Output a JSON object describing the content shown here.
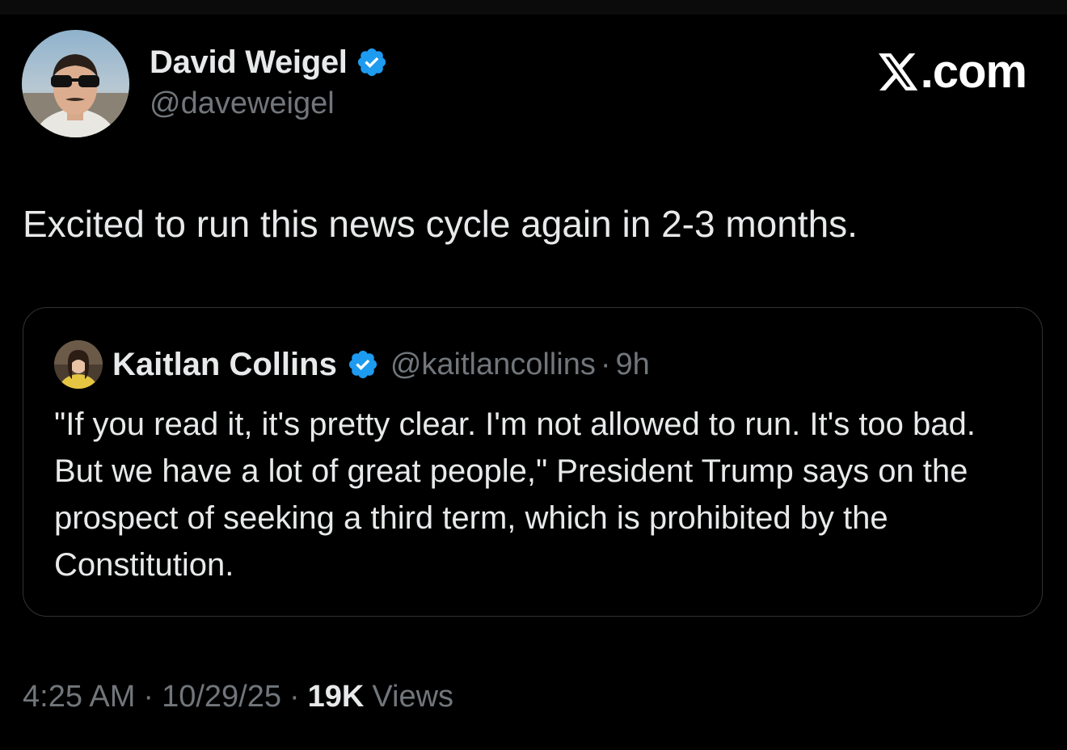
{
  "tweet": {
    "author": {
      "name": "David Weigel",
      "handle": "@daveweigel",
      "verified": true,
      "avatar": "author-avatar-photo"
    },
    "brand": {
      "label": ".com",
      "icon": "x-logo-icon",
      "color": "#ffffff"
    },
    "text": "Excited to run this news cycle again in 2-3 months.",
    "quoted": {
      "author_name": "Kaitlan Collins",
      "handle": "@kaitlancollins",
      "separator": "·",
      "time": "9h",
      "verified": true,
      "text": "\"If you read it, it's pretty clear. I'm not allowed to run. It's too bad. But we have a lot of great people,\" President Trump says on the prospect of seeking a third term, which is prohibited by the Constitution."
    },
    "meta": {
      "time": "4:25 AM",
      "separator": "·",
      "date": "10/29/25",
      "views_count": "19K",
      "views_label": "Views"
    }
  },
  "colors": {
    "background": "#000000",
    "primary_text": "#e7e9ea",
    "secondary_text": "#71767b",
    "verified_badge": "#1d9bf0",
    "border": "#2f3336"
  }
}
